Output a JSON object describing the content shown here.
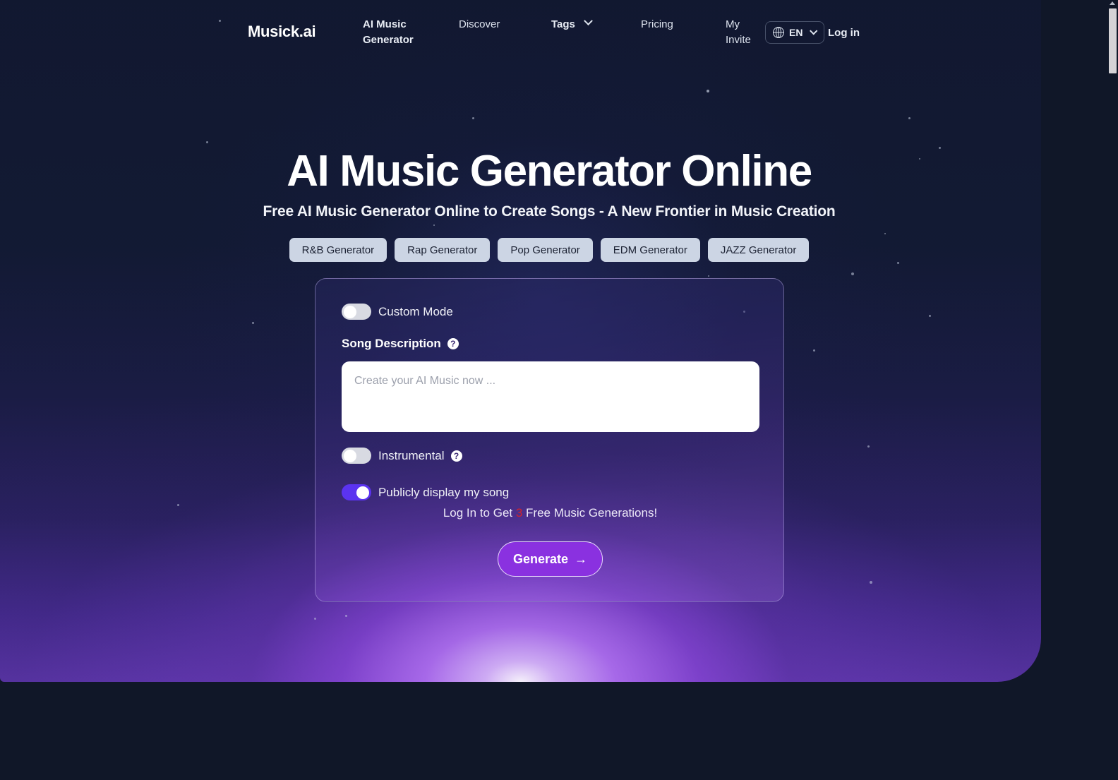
{
  "navbar": {
    "brand": "Musick.ai",
    "links": [
      {
        "label": "AI Music Generator",
        "name": "nav-ai-music-generator"
      },
      {
        "label": "Discover",
        "name": "nav-discover"
      },
      {
        "label": "Tags",
        "name": "nav-tags"
      },
      {
        "label": "Pricing",
        "name": "nav-pricing"
      },
      {
        "label": "My Invite",
        "name": "nav-my-invite"
      }
    ],
    "language": "EN",
    "login": "Log in"
  },
  "hero": {
    "title": "AI Music Generator Online",
    "subtitle": "Free AI Music Generator Online to Create Songs - A New Frontier in Music Creation",
    "chips": [
      "R&B Generator",
      "Rap Generator",
      "Pop Generator",
      "EDM Generator",
      "JAZZ Generator"
    ]
  },
  "generator": {
    "custom_mode_label": "Custom Mode",
    "custom_mode_state": "off",
    "song_description_label": "Song Description",
    "song_description_value": "",
    "song_description_placeholder": "Create your AI Music now ...",
    "instrumental_label": "Instrumental",
    "instrumental_state": "off",
    "public_label": "Publicly display my song",
    "public_state": "on",
    "login_note_prefix": "Log In to Get ",
    "login_note_count": "3",
    "login_note_suffix": " Free Music Generations!",
    "generate_label": "Generate",
    "generate_arrow": "→",
    "help_glyph": "?"
  },
  "colors": {
    "page_background": "#101728",
    "accent_purple": "#8a31e0",
    "toggle_on": "#5b33f0",
    "chip_background": "#ccd5e4",
    "count_red": "#d2232a"
  }
}
